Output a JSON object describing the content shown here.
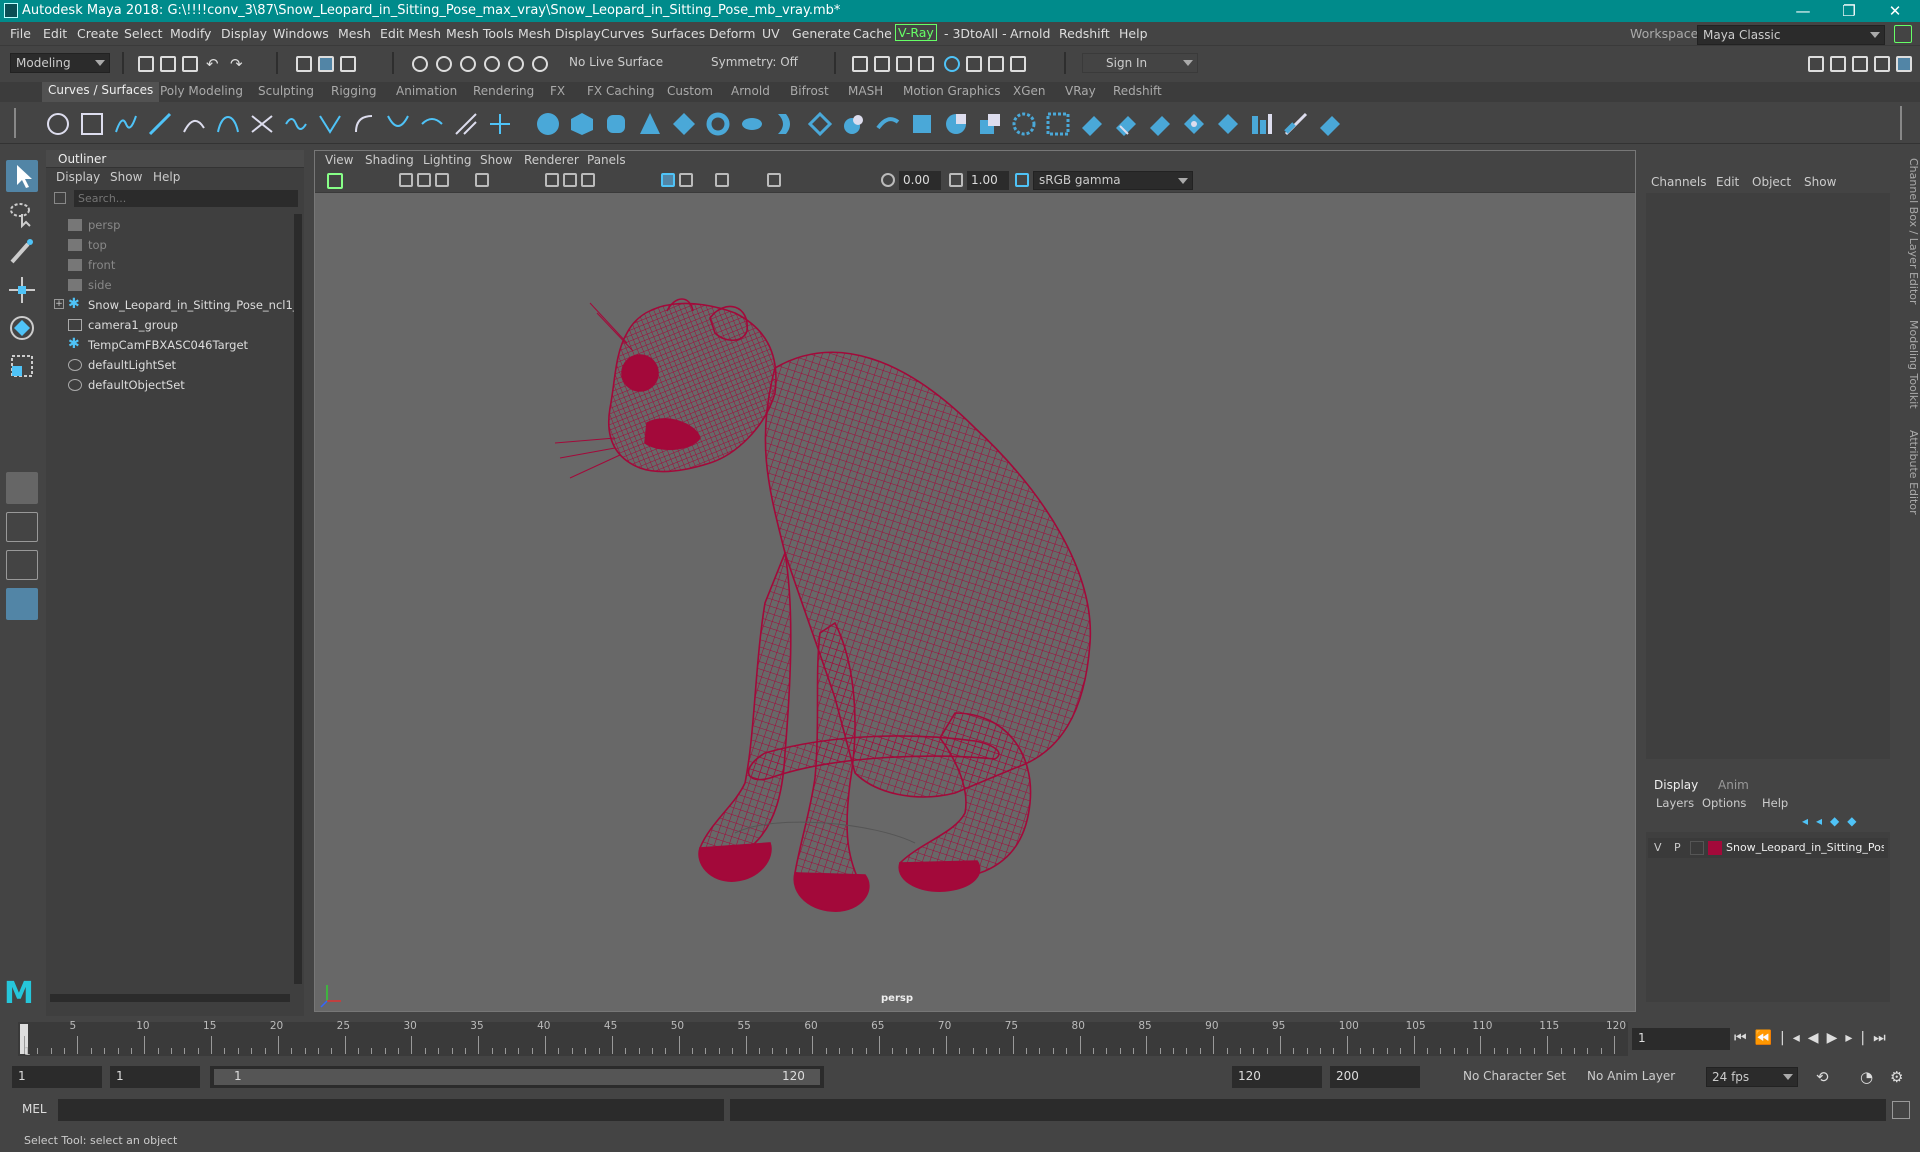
{
  "titlebar": {
    "title": "Autodesk Maya 2018: G:\\!!!!conv_3\\87\\Snow_Leopard_in_Sitting_Pose_max_vray\\Snow_Leopard_in_Sitting_Pose_mb_vray.mb*",
    "minimize": "—",
    "restore": "❐",
    "close": "✕"
  },
  "menubar": {
    "items": [
      "File",
      "Edit",
      "Create",
      "Select",
      "Modify",
      "Display",
      "Windows",
      "Mesh",
      "Edit Mesh",
      "Mesh Tools",
      "Mesh Display",
      "Curves",
      "Surfaces",
      "Deform",
      "UV",
      "Generate",
      "Cache",
      "V-Ray",
      "- 3DtoAll -",
      "Arnold",
      "Redshift",
      "Help"
    ],
    "workspace_label": "Workspace :",
    "workspace_value": "Maya Classic"
  },
  "statusline": {
    "mode": "Modeling",
    "live_surface": "No Live Surface",
    "symmetry": "Symmetry: Off",
    "sign_in": "Sign In"
  },
  "shelf": {
    "tabs": [
      "Curves / Surfaces",
      "Poly Modeling",
      "Sculpting",
      "Rigging",
      "Animation",
      "Rendering",
      "FX",
      "FX Caching",
      "Custom",
      "Arnold",
      "Bifrost",
      "MASH",
      "Motion Graphics",
      "XGen",
      "VRay",
      "Redshift"
    ],
    "active_tab": "Curves / Surfaces"
  },
  "outliner": {
    "title": "Outliner",
    "menu": [
      "Display",
      "Show",
      "Help"
    ],
    "search_placeholder": "Search...",
    "items": [
      {
        "label": "persp",
        "icon": "camera-icon",
        "dim": true
      },
      {
        "label": "top",
        "icon": "camera-icon",
        "dim": true
      },
      {
        "label": "front",
        "icon": "camera-icon",
        "dim": true
      },
      {
        "label": "side",
        "icon": "camera-icon",
        "dim": true
      },
      {
        "label": "Snow_Leopard_in_Sitting_Pose_ncl1_",
        "icon": "transform-icon",
        "dim": false,
        "expandable": true
      },
      {
        "label": "camera1_group",
        "icon": "group-icon",
        "dim": false
      },
      {
        "label": "TempCamFBXASC046Target",
        "icon": "transform-icon",
        "dim": false
      },
      {
        "label": "defaultLightSet",
        "icon": "set-icon",
        "dim": false
      },
      {
        "label": "defaultObjectSet",
        "icon": "set-icon",
        "dim": false
      }
    ]
  },
  "viewport": {
    "menu": [
      "View",
      "Shading",
      "Lighting",
      "Show",
      "Renderer",
      "Panels"
    ],
    "exposure": "0.00",
    "gamma": "1.00",
    "color_space": "sRGB gamma",
    "camera_label": "persp",
    "wire_color": "#a3093a"
  },
  "channelbox": {
    "menu": [
      "Channels",
      "Edit",
      "Object",
      "Show"
    ],
    "side_tabs": [
      "Channel Box / Layer Editor",
      "Modeling Toolkit",
      "Attribute Editor"
    ]
  },
  "layers": {
    "tabs": [
      "Display",
      "Anim"
    ],
    "active_tab": "Display",
    "menu": [
      "Layers",
      "Options",
      "Help"
    ],
    "rows": [
      {
        "v": "V",
        "p": "P",
        "color": "#a3093a",
        "name": "Snow_Leopard_in_Sitting_Pose"
      }
    ]
  },
  "timeline": {
    "ticks": [
      "1",
      "5",
      "10",
      "15",
      "20",
      "25",
      "30",
      "35",
      "40",
      "45",
      "50",
      "55",
      "60",
      "65",
      "70",
      "75",
      "80",
      "85",
      "90",
      "95",
      "100",
      "105",
      "110",
      "115",
      "120"
    ],
    "current_frame": "1"
  },
  "range": {
    "start": "1",
    "playback_start": "1",
    "slider_start": "1",
    "slider_end": "120",
    "playback_end": "120",
    "end": "200",
    "character_set": "No Character Set",
    "anim_layer": "No Anim Layer",
    "fps": "24 fps"
  },
  "command": {
    "label": "MEL"
  },
  "help": {
    "text": "Select Tool: select an object"
  }
}
